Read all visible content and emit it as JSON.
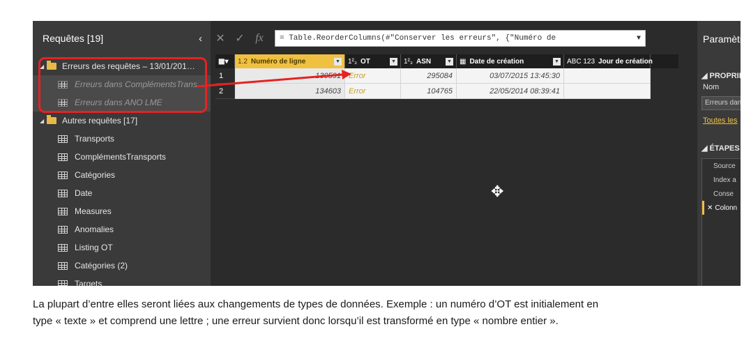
{
  "queries": {
    "header": "Requêtes [19]",
    "collapse_icon": "‹",
    "groups": [
      {
        "label": "Erreurs des requêtes – 13/01/201…",
        "items": [
          "Erreurs dans ComplémentsTrans…",
          "Erreurs dans ANO LME"
        ]
      },
      {
        "label": "Autres requêtes [17]",
        "items": [
          "Transports",
          "ComplémentsTransports",
          "Catégories",
          "Date",
          "Measures",
          "Anomalies",
          "Listing OT",
          "Catégories (2)",
          "Targets"
        ]
      }
    ]
  },
  "formula_bar": {
    "cancel_icon": "✕",
    "confirm_icon": "✓",
    "fx_label": "fx",
    "formula": "= Table.ReorderColumns(#\"Conserver les erreurs\", {\"Numéro de"
  },
  "grid": {
    "columns": [
      {
        "type": "1.2",
        "name": "Numéro de ligne"
      },
      {
        "type": "1²₃",
        "name": "OT"
      },
      {
        "type": "1²₃",
        "name": "ASN"
      },
      {
        "type": "▦",
        "name": "Date de création"
      },
      {
        "type": "ABC 123",
        "name": "Jour de création"
      }
    ],
    "rows": [
      {
        "index": "1",
        "numero": "130591",
        "ot": "Error",
        "asn": "295084",
        "date": "03/07/2015 13:45:30",
        "jour": ""
      },
      {
        "index": "2",
        "numero": "134603",
        "ot": "Error",
        "asn": "104765",
        "date": "22/05/2014 08:39:41",
        "jour": ""
      }
    ]
  },
  "settings": {
    "title": "Paramètres",
    "properties_header": "◢ PROPRIÉT",
    "name_label": "Nom",
    "name_value": "Erreurs dans",
    "all_props_link": "Toutes les",
    "steps_header": "◢ ÉTAPES AP",
    "steps": [
      "Source",
      "Index a",
      "Conse",
      "Colonn"
    ]
  },
  "caption": {
    "line1": "La plupart d’entre elles seront liées aux changements de types de données. Exemple : un numéro d’OT est initialement en",
    "line2": "type « texte » et comprend une lettre ; une erreur survient donc lorsqu’il est transformé en type « nombre entier »."
  },
  "colors": {
    "accent": "#f0c040",
    "error": "#c9a020",
    "highlight": "#e62222"
  }
}
